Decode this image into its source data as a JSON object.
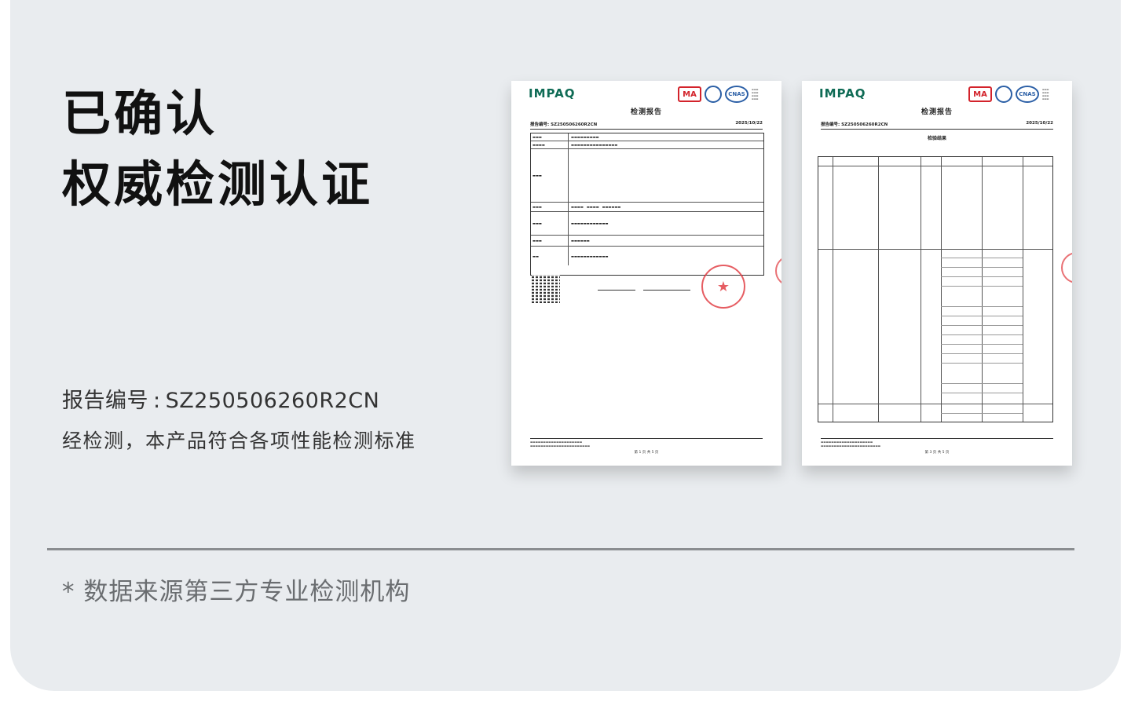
{
  "heading": {
    "line1": "已确认",
    "line2": "权威检测认证"
  },
  "report": {
    "label": "报告编号",
    "separator": ":",
    "number": "SZ250506260R2CN"
  },
  "description": "经检测，本产品符合各项性能检测标准",
  "source_note": "* 数据来源第三方专业检测机构",
  "sheets": [
    {
      "brand": "IMPAQ",
      "title": "检测报告",
      "report_no": "报告编号: SZ250506260R2CN",
      "date": "2025/10/22",
      "page": "第 1 页 共 5 页"
    },
    {
      "brand": "IMPAQ",
      "title": "检测报告",
      "report_no": "报告编号: SZ250506260R2CN",
      "date": "2025/10/22",
      "section": "检验结果",
      "page": "第 3 页 共 5 页"
    }
  ],
  "logos": {
    "ma": "MA",
    "ilac": "ilac-MRA",
    "cnas": "CNAS"
  },
  "colors": {
    "panel": "#e9ecef",
    "brand_green": "#0f6b55",
    "stamp_red": "#e0353b"
  }
}
